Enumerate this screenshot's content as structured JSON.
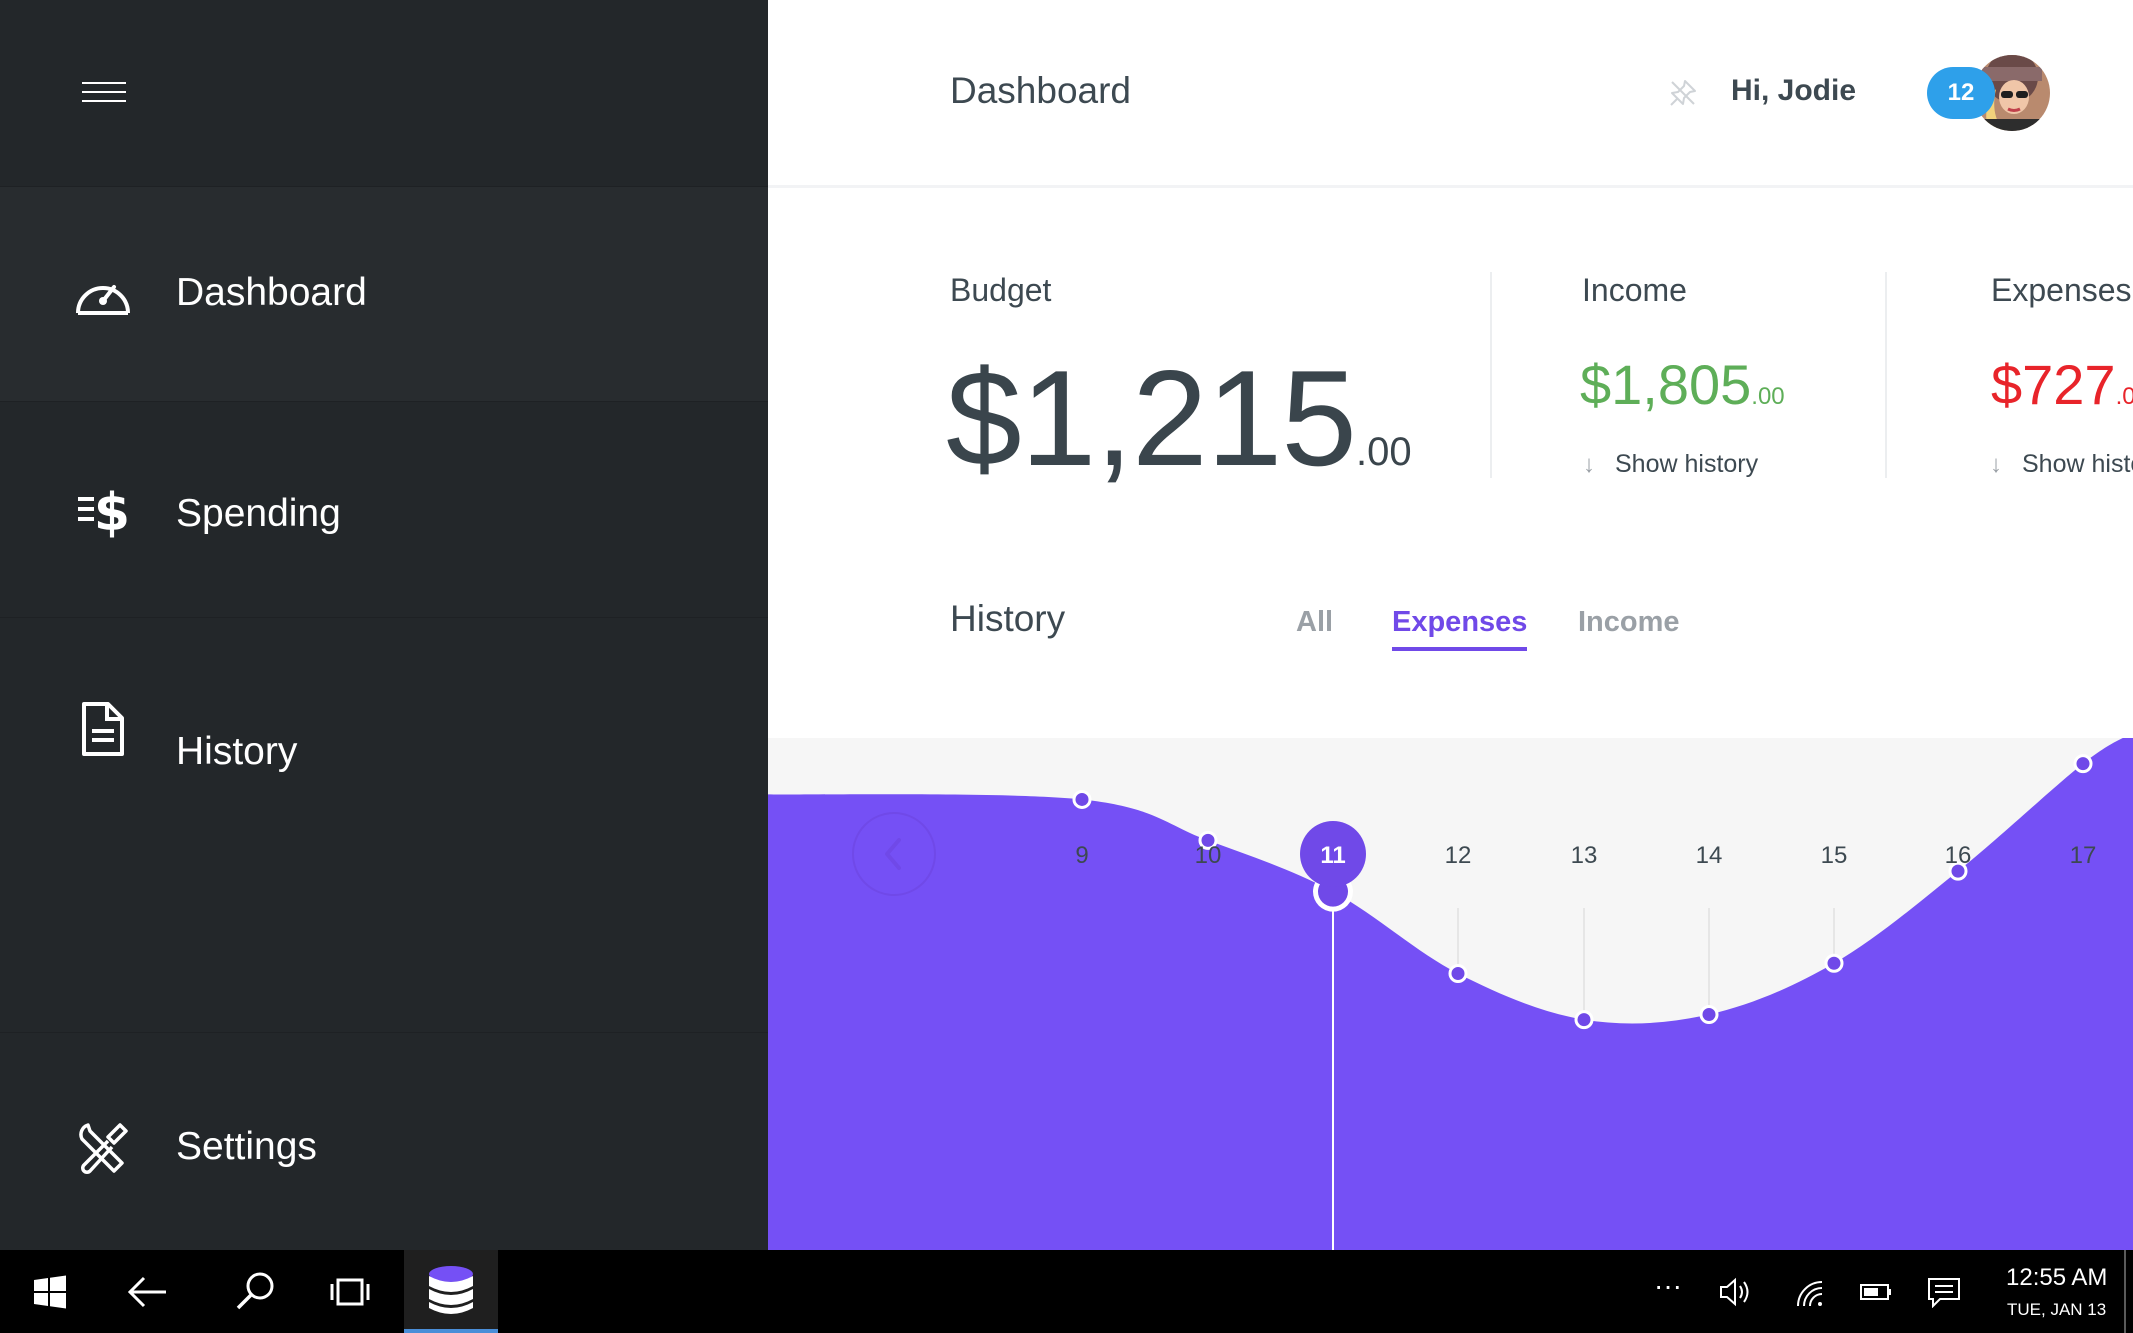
{
  "sidebar": {
    "items": [
      {
        "label": "Dashboard",
        "icon": "speedometer-icon"
      },
      {
        "label": "Spending",
        "icon": "dollar-speed-icon"
      },
      {
        "label": "History",
        "icon": "document-icon"
      },
      {
        "label": "Settings",
        "icon": "wrench-screwdriver-icon"
      }
    ]
  },
  "header": {
    "title": "Dashboard",
    "greeting": "Hi, Jodie",
    "notification_count": "12"
  },
  "stats": {
    "budget": {
      "label": "Budget",
      "dollars": "$1,215",
      "cents": ".00"
    },
    "income": {
      "label": "Income",
      "dollars": "$1,805",
      "cents": ".00",
      "link": "Show history"
    },
    "expenses": {
      "label": "Expenses",
      "dollars": "$727",
      "cents": ".00",
      "link": "Show history"
    }
  },
  "history": {
    "title": "History",
    "tabs": [
      "All",
      "Expenses",
      "Income"
    ],
    "active_tab": "Expenses"
  },
  "chart_data": {
    "type": "area",
    "x": [
      "9",
      "10",
      "11",
      "12",
      "13",
      "14",
      "15",
      "16",
      "17"
    ],
    "selected": "11",
    "values": [
      88,
      80,
      70,
      54,
      45,
      46,
      56,
      74,
      95
    ],
    "ylim": [
      0,
      100
    ],
    "series": [
      {
        "values": [
          88,
          80,
          70,
          54,
          45,
          46,
          56,
          74,
          95
        ]
      }
    ]
  },
  "taskbar": {
    "time": "12:55 AM",
    "date": "TUE, JAN 13",
    "overflow": "···"
  },
  "colors": {
    "accent": "#7049e8",
    "sidebar": "#23272a",
    "income": "#5eae58",
    "expenses": "#e8242a",
    "badge": "#2ea0ea"
  }
}
